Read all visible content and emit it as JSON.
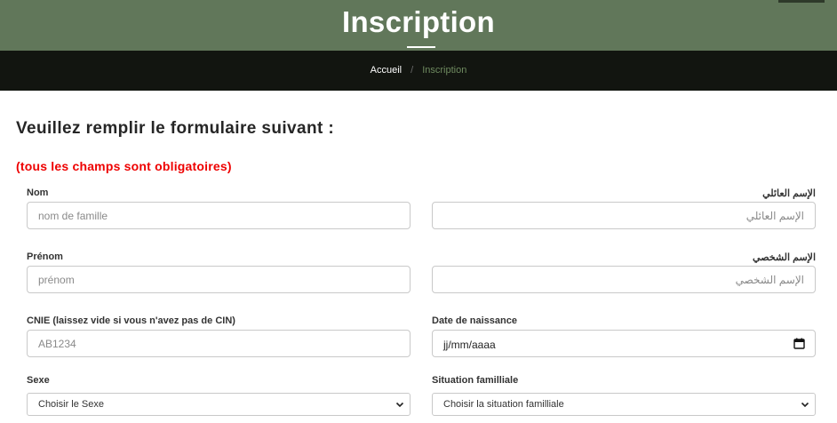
{
  "header": {
    "title": "Inscription"
  },
  "breadcrumb": {
    "home": "Accueil",
    "separator": "/",
    "current": "Inscription"
  },
  "form": {
    "heading": "Veuillez remplir le formulaire suivant :",
    "required_note": "(tous les champs sont obligatoires)",
    "nom": {
      "label": "Nom",
      "placeholder": "nom de famille"
    },
    "nom_ar": {
      "label": "الإسم العائلي",
      "placeholder": "الإسم العائلي"
    },
    "prenom": {
      "label": "Prénom",
      "placeholder": "prénom"
    },
    "prenom_ar": {
      "label": "الإسم الشخصي",
      "placeholder": "الإسم الشخصي"
    },
    "cnie": {
      "label": "CNIE (laissez vide si vous n'avez pas de CIN)",
      "placeholder": "AB1234"
    },
    "date_naissance": {
      "label": "Date de naissance",
      "value": "jj/mm/aaaa"
    },
    "sexe": {
      "label": "Sexe",
      "selected": "Choisir le Sexe"
    },
    "situation": {
      "label": "Situation familliale",
      "selected": "Choisir la situation familliale"
    }
  },
  "icons": {
    "date_picker": "calendar-icon",
    "select_arrow": "chevron-down-icon"
  },
  "colors": {
    "hero": "#61775a",
    "breadcrumb_bar": "#121510",
    "breadcrumb_current": "#6e8a5f",
    "required": "#ee0000"
  }
}
